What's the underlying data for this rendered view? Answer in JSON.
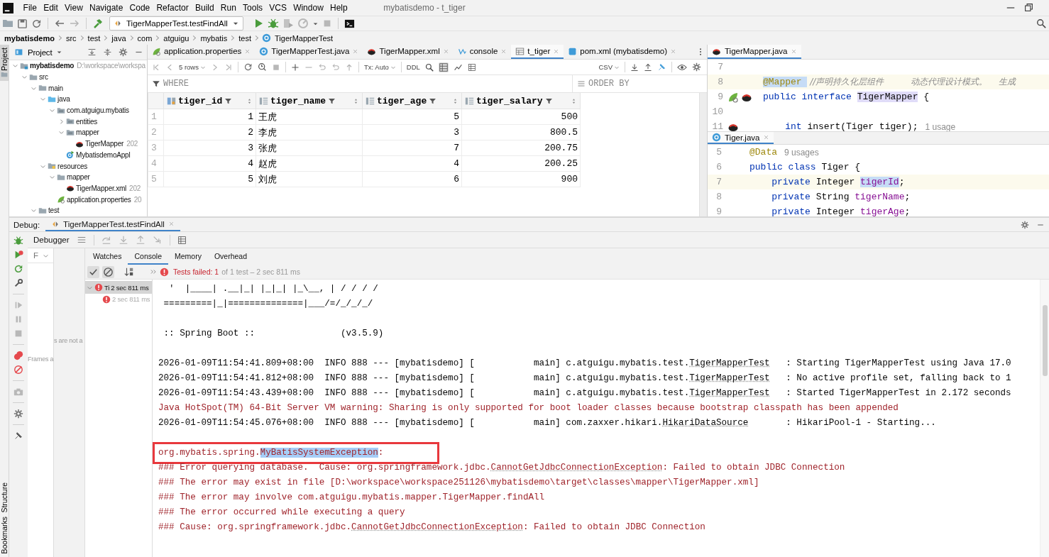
{
  "window": {
    "title": "mybatisdemo - t_tiger"
  },
  "menu": [
    "File",
    "Edit",
    "View",
    "Navigate",
    "Code",
    "Refactor",
    "Build",
    "Run",
    "Tools",
    "VCS",
    "Window",
    "Help"
  ],
  "toolbar": {
    "run_configuration": "TigerMapperTest.testFindAll"
  },
  "breadcrumb": [
    "mybatisdemo",
    "src",
    "test",
    "java",
    "com",
    "atguigu",
    "mybatis",
    "test",
    "TigerMapperTest"
  ],
  "side_stripe": {
    "top": "Project",
    "bottom": [
      "Structure",
      "Bookmarks"
    ]
  },
  "project": {
    "title": "Project",
    "tree": [
      {
        "label": "mybatisdemo",
        "note": "D:\\workspace\\workspa",
        "kind": "module",
        "expanded": true,
        "children": [
          {
            "label": "src",
            "kind": "folder",
            "expanded": true,
            "children": [
              {
                "label": "main",
                "kind": "folder",
                "expanded": true,
                "children": [
                  {
                    "label": "java",
                    "kind": "source",
                    "expanded": true,
                    "children": [
                      {
                        "label": "com.atguigu.mybatis",
                        "kind": "package",
                        "expanded": true,
                        "children": [
                          {
                            "label": "entities",
                            "kind": "package",
                            "expanded": false
                          },
                          {
                            "label": "mapper",
                            "kind": "package",
                            "expanded": true,
                            "children": [
                              {
                                "label": "TigerMapper",
                                "note": "202",
                                "kind": "mapper"
                              }
                            ]
                          },
                          {
                            "label": "MybatisdemoAppl",
                            "kind": "app"
                          }
                        ]
                      }
                    ]
                  },
                  {
                    "label": "resources",
                    "kind": "resources",
                    "expanded": true,
                    "children": [
                      {
                        "label": "mapper",
                        "kind": "folder",
                        "expanded": true,
                        "children": [
                          {
                            "label": "TigerMapper.xml",
                            "note": "202",
                            "kind": "mapper"
                          }
                        ]
                      },
                      {
                        "label": "application.properties",
                        "note": "20",
                        "kind": "properties"
                      }
                    ]
                  }
                ]
              },
              {
                "label": "test",
                "kind": "folder",
                "expanded": true
              }
            ]
          }
        ]
      }
    ]
  },
  "editor_tabs": [
    {
      "label": "application.properties",
      "kind": "properties",
      "selected": false
    },
    {
      "label": "TigerMapperTest.java",
      "kind": "class",
      "selected": false
    },
    {
      "label": "TigerMapper.xml",
      "kind": "mapper",
      "selected": false
    },
    {
      "label": "console",
      "kind": "console",
      "selected": false
    },
    {
      "label": "t_tiger",
      "kind": "table",
      "selected": true
    },
    {
      "label": "pom.xml (mybatisdemo)",
      "kind": "file",
      "selected": false
    }
  ],
  "table": {
    "rows_label": "5 rows",
    "transaction": "Tx: Auto",
    "ddl": "DDL",
    "export_format": "CSV",
    "where": "WHERE",
    "order_by": "ORDER BY",
    "columns": [
      {
        "name": "tiger_id",
        "kind": "key"
      },
      {
        "name": "tiger_name",
        "kind": "column"
      },
      {
        "name": "tiger_age",
        "kind": "column"
      },
      {
        "name": "tiger_salary",
        "kind": "column"
      }
    ],
    "rows": [
      {
        "num": "1",
        "cells": [
          "1",
          "王虎",
          "5",
          "500"
        ]
      },
      {
        "num": "2",
        "cells": [
          "2",
          "李虎",
          "3",
          "800.5"
        ]
      },
      {
        "num": "3",
        "cells": [
          "3",
          "张虎",
          "7",
          "200.75"
        ]
      },
      {
        "num": "4",
        "cells": [
          "4",
          "赵虎",
          "4",
          "200.25"
        ]
      },
      {
        "num": "5",
        "cells": [
          "5",
          "刘虎",
          "6",
          "900"
        ]
      }
    ]
  },
  "editors": [
    {
      "tab": {
        "label": "TigerMapper.java",
        "kind": "mapper"
      },
      "lines": [
        {
          "num": "7",
          "current": false
        },
        {
          "num": "8",
          "current": true,
          "tokens": [
            {
              "text": "@Mapper ",
              "kind": "annotation_match"
            },
            {
              "text": " //声明持久化层组件          动态代理设计模式。    生成",
              "kind": "comment"
            }
          ]
        },
        {
          "num": "9",
          "current": false,
          "gutter": [
            {
              "kind": "leaf"
            },
            {
              "kind": "mapper"
            }
          ],
          "tokens": [
            {
              "text": "public interface ",
              "kind": "keyword"
            },
            {
              "text": "TigerMapper",
              "kind": "type_match"
            },
            {
              "text": " {",
              "kind": "plain"
            }
          ]
        },
        {
          "num": "10",
          "current": false
        },
        {
          "num": "11",
          "current": false,
          "gutter": [
            {
              "kind": "mapper"
            }
          ],
          "tokens": [
            {
              "text": "    int ",
              "kind": "keyword"
            },
            {
              "text": "insert(Tiger tiger);",
              "kind": "plain"
            }
          ],
          "hint": "1 usage"
        }
      ]
    },
    {
      "tab": {
        "label": "Tiger.java",
        "kind": "class"
      },
      "lines": [
        {
          "num": "5",
          "current": false,
          "tokens": [
            {
              "text": "@Data",
              "kind": "annotation"
            }
          ],
          "hint": "9 usages"
        },
        {
          "num": "6",
          "current": false,
          "tokens": [
            {
              "text": "public class ",
              "kind": "keyword"
            },
            {
              "text": "Tiger {",
              "kind": "plain"
            }
          ]
        },
        {
          "num": "7",
          "current": true,
          "tokens": [
            {
              "text": "    private ",
              "kind": "keyword"
            },
            {
              "text": "Integer ",
              "kind": "plain"
            },
            {
              "text": "tigerId",
              "kind": "field_match"
            },
            {
              "text": ";",
              "kind": "plain"
            }
          ]
        },
        {
          "num": "8",
          "current": false,
          "tokens": [
            {
              "text": "    private ",
              "kind": "keyword"
            },
            {
              "text": "String ",
              "kind": "plain"
            },
            {
              "text": "tigerName",
              "kind": "field"
            },
            {
              "text": ";",
              "kind": "plain"
            }
          ]
        },
        {
          "num": "9",
          "current": false,
          "tokens": [
            {
              "text": "    private ",
              "kind": "keyword"
            },
            {
              "text": "Integer ",
              "kind": "plain"
            },
            {
              "text": "tigerAge",
              "kind": "field"
            },
            {
              "text": ";",
              "kind": "plain"
            }
          ]
        }
      ]
    }
  ],
  "debug": {
    "label": "Debug:",
    "session_tab": "TigerMapperTest.testFindAll",
    "debugger_tab": "Debugger",
    "frames_dropdown": "F",
    "frames_note": "Frames a",
    "threads_note": "s are not a",
    "tabs": [
      {
        "label": "Watches",
        "selected": false
      },
      {
        "label": "Console",
        "selected": true
      },
      {
        "label": "Memory",
        "selected": false
      },
      {
        "label": "Overhead",
        "selected": false
      }
    ],
    "test_status": {
      "failed": "Tests failed: 1",
      "summary": "of 1 test – 2 sec 811 ms"
    },
    "test_tree": [
      {
        "label": "Ti",
        "time": "2 sec 811 ms",
        "kind": "failed",
        "selected": true,
        "expanded": true,
        "children": [
          {
            "time": "2 sec 811 ms",
            "kind": "failed",
            "selected": false
          }
        ]
      }
    ],
    "console": [
      {
        "kind": "info",
        "boxed": false,
        "segments": [
          {
            "text": "  '  |____| .__|_| |_|_| |_\\__, | / / / /",
            "kind": "plain"
          }
        ]
      },
      {
        "kind": "info",
        "boxed": false,
        "segments": [
          {
            "text": " =========|_|==============|___/=/_/_/_/",
            "kind": "plain"
          }
        ]
      },
      {
        "kind": "blank",
        "boxed": false
      },
      {
        "kind": "info",
        "boxed": false,
        "segments": [
          {
            "text": " :: Spring Boot ::                (v3.5.9)",
            "kind": "plain"
          }
        ]
      },
      {
        "kind": "blank",
        "boxed": false
      },
      {
        "kind": "info",
        "boxed": false,
        "segments": [
          {
            "text": "2026-01-09T11:54:41.809+08:00  INFO 888 --- [mybatisdemo] [           main] c.atguigu.mybatis.test.",
            "kind": "plain"
          },
          {
            "text": "TigerMapperTest",
            "kind": "link"
          },
          {
            "text": "   : Starting TigerMapperTest using Java 17.0",
            "kind": "plain"
          }
        ]
      },
      {
        "kind": "info",
        "boxed": false,
        "segments": [
          {
            "text": "2026-01-09T11:54:41.812+08:00  INFO 888 --- [mybatisdemo] [           main] c.atguigu.mybatis.test.",
            "kind": "plain"
          },
          {
            "text": "TigerMapperTest",
            "kind": "link"
          },
          {
            "text": "   : No active profile set, falling back to 1",
            "kind": "plain"
          }
        ]
      },
      {
        "kind": "info",
        "boxed": false,
        "segments": [
          {
            "text": "2026-01-09T11:54:43.439+08:00  INFO 888 --- [mybatisdemo] [           main] c.atguigu.mybatis.test.",
            "kind": "plain"
          },
          {
            "text": "TigerMapperTest",
            "kind": "link"
          },
          {
            "text": "   : Started TigerMapperTest in 2.172 seconds",
            "kind": "plain"
          }
        ]
      },
      {
        "kind": "error",
        "boxed": false,
        "segments": [
          {
            "text": "Java HotSpot(TM) 64-Bit Server VM warning: Sharing is only supported for boot loader classes because bootstrap classpath has been appended",
            "kind": "plain"
          }
        ]
      },
      {
        "kind": "info",
        "boxed": false,
        "segments": [
          {
            "text": "2026-01-09T11:54:45.076+08:00  INFO 888 --- [mybatisdemo] [           main] com.zaxxer.hikari.",
            "kind": "plain"
          },
          {
            "text": "HikariDataSource",
            "kind": "link"
          },
          {
            "text": "       : HikariPool-1 - Starting...",
            "kind": "plain"
          }
        ]
      },
      {
        "kind": "blank",
        "boxed": false
      },
      {
        "kind": "error",
        "boxed": true,
        "segments": [
          {
            "text": "org.mybatis.spring.",
            "kind": "plain"
          },
          {
            "text": "MyBatisSystemException",
            "kind": "selected"
          },
          {
            "text": ":",
            "kind": "plain"
          }
        ]
      },
      {
        "kind": "error",
        "boxed": false,
        "segments": [
          {
            "text": "### Error querying database.  Cause: org.springframework.jdbc.",
            "kind": "plain"
          },
          {
            "text": "CannotGetJdbcConnectionException",
            "kind": "link"
          },
          {
            "text": ": Failed to obtain JDBC Connection",
            "kind": "plain"
          }
        ]
      },
      {
        "kind": "error",
        "boxed": false,
        "segments": [
          {
            "text": "### The error may exist in file [D:\\workspace\\workspace251126\\mybatisdemo\\target\\classes\\mapper\\TigerMapper.xml]",
            "kind": "plain"
          }
        ]
      },
      {
        "kind": "error",
        "boxed": false,
        "segments": [
          {
            "text": "### The error may involve com.atguigu.mybatis.mapper.TigerMapper.findAll",
            "kind": "plain"
          }
        ]
      },
      {
        "kind": "error",
        "boxed": false,
        "segments": [
          {
            "text": "### The error occurred while executing a query",
            "kind": "plain"
          }
        ]
      },
      {
        "kind": "error",
        "boxed": false,
        "segments": [
          {
            "text": "### Cause: org.springframework.jdbc.",
            "kind": "plain"
          },
          {
            "text": "CannotGetJdbcConnectionException",
            "kind": "link"
          },
          {
            "text": ": Failed to obtain JDBC Connection",
            "kind": "plain"
          }
        ]
      }
    ]
  }
}
